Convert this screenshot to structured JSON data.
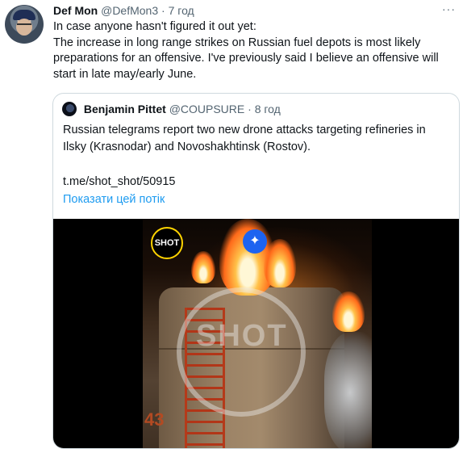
{
  "tweet": {
    "author_name": "Def Mon",
    "author_handle": "@DefMon3",
    "separator": "·",
    "time": "7 год",
    "more_icon": "more-dots-icon",
    "lines": [
      "In case anyone hasn't figured it out yet:",
      "The increase in long range strikes on Russian fuel depots is most likely preparations for an offensive. I've previously said I believe an offensive will start in late may/early June."
    ]
  },
  "quote": {
    "author_name": "Benjamin Pittet",
    "author_handle": "@COUPSURE",
    "separator": "·",
    "time": "8 год",
    "text": "Russian telegrams report two new drone attacks targeting refineries in Ilsky (Krasnodar) and Novoshakhtinsk (Rostov).",
    "link": "t.me/shot_shot/50915",
    "show_thread": "Показати цей потік",
    "media": {
      "badge": "SHOT",
      "watermark": "SHOT",
      "tank_number": "43",
      "spark_icon": "sparkle-icon"
    }
  },
  "colors": {
    "accent": "#1d9bf0",
    "secondary_text": "#536471",
    "border": "#cfd9de"
  }
}
